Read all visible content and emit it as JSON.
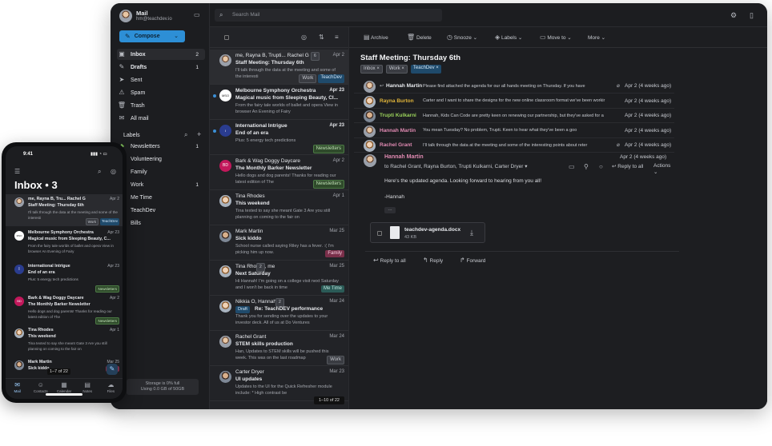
{
  "account": {
    "name": "Mail",
    "email": "hm@teachdev.io"
  },
  "search": {
    "placeholder": "Search Mail"
  },
  "compose": {
    "label": "Compose"
  },
  "folders": [
    {
      "label": "Inbox",
      "count": "2",
      "icon": "inbox-icon"
    },
    {
      "label": "Drafts",
      "count": "1",
      "icon": "drafts-icon"
    },
    {
      "label": "Sent",
      "count": "",
      "icon": "sent-icon"
    },
    {
      "label": "Spam",
      "count": "",
      "icon": "spam-icon"
    },
    {
      "label": "Trash",
      "count": "",
      "icon": "trash-icon"
    },
    {
      "label": "All mail",
      "count": "",
      "icon": "all-mail-icon"
    }
  ],
  "labels_heading": "Labels",
  "labels": [
    {
      "label": "Newsletters",
      "count": "1",
      "color": "#7fbf5a"
    },
    {
      "label": "Volunteering",
      "count": "",
      "color": "#e0a23a"
    },
    {
      "label": "Family",
      "count": "",
      "color": "#d9487a"
    },
    {
      "label": "Work",
      "count": "1",
      "color": "#9aa0aa"
    },
    {
      "label": "Me Time",
      "count": "",
      "color": "#3fb3a6"
    },
    {
      "label": "TeachDev",
      "count": "",
      "color": "#3b8fd6"
    },
    {
      "label": "Bills",
      "count": "",
      "color": "#e0a23a"
    }
  ],
  "storage": {
    "line1": "Storage is 0% full",
    "line2": "Using 0.0 GB of 50GB"
  },
  "toolbar": {
    "archive": "Archive",
    "delete": "Delete",
    "snooze": "Snooze",
    "labels": "Labels",
    "move_to": "Move to",
    "more": "More"
  },
  "messages": [
    {
      "from": "me, Rayna B, Trupti... Rachel G",
      "count": "6",
      "date": "Apr 2",
      "subject": "Staff Meeting: Thursday 6th",
      "preview": "I'll talk through the data at the meeting and some of the interesti",
      "tags": [
        "Work",
        "TeachDev"
      ]
    },
    {
      "from": "Melbourne Symphony Orchestra",
      "count": "",
      "date": "Apr 23",
      "subject": "Magical music from Sleeping Beauty, Cl...",
      "preview": "From the fairy tale worlds of ballet and opera View in browser An Evening of Fairy",
      "tags": []
    },
    {
      "from": "International Intrigue",
      "count": "",
      "date": "Apr 23",
      "subject": "End of an era",
      "preview": "Plus: 5 energy tech predictions",
      "tags": [
        "Newsletters"
      ]
    },
    {
      "from": "Bark & Wag Doggy Daycare",
      "count": "",
      "date": "Apr 2",
      "subject": "The Monthly Barker Newsletter",
      "preview": "Hello dogs and dog parents! Thanks for reading our latest edition of The",
      "tags": [
        "Newsletters"
      ]
    },
    {
      "from": "Tina Rhodes",
      "count": "",
      "date": "Apr 1",
      "subject": "This weekend",
      "preview": "Tina texted to say she meant Gate 3 Are you still planning on coming to the fair on",
      "tags": []
    },
    {
      "from": "Mark Martin",
      "count": "",
      "date": "Mar 25",
      "subject": "Sick kiddo",
      "preview": "School nurse called saying Riley has a fever. :( I'm picking him up now.",
      "tags": [
        "Family"
      ]
    },
    {
      "from": "Tina Rhodes, me",
      "count": "2",
      "date": "Mar 25",
      "subject": "Next Saturday",
      "preview": "Hi Hannah! I'm going on a college visit next Saturday and I won't be back in time",
      "tags": [
        "Me Time"
      ]
    },
    {
      "from": "Nikkia O, Hannah M",
      "count": "2",
      "date": "Mar 24",
      "subject": "Re: TeachDEV performance",
      "preview": "Thank you for sending over the updates to your investor deck. All of us at Do Ventures",
      "tags": [],
      "draft": "Draft"
    },
    {
      "from": "Rachel Grant",
      "count": "",
      "date": "Mar 24",
      "subject": "STEM skills production",
      "preview": "Han, Updates to STEM skills will be pushed this week. This was on the last roadmap",
      "tags": [
        "Work"
      ]
    },
    {
      "from": "Carter Dryer",
      "count": "",
      "date": "Mar 23",
      "subject": "UI updates",
      "preview": "Updates to the UI for the Quick Refresher module include: * High contrast be",
      "tags": []
    }
  ],
  "pagination": "1–10 of 22",
  "thread": {
    "title": "Staff Meeting: Thursday 6th",
    "tags": [
      "Inbox",
      "Work",
      "TeachDev"
    ],
    "items": [
      {
        "from": "Hannah Martin",
        "snippet": "Please find attached the agenda for our all hands meeting on Thursday. If you have",
        "date": "Apr 2 (4 weeks ago)",
        "color": "#e6e8ec"
      },
      {
        "from": "Rayna Burton",
        "snippet": "Carter and I want to share the designs for the new online classroom format we've been workir",
        "date": "Apr 2 (4 weeks ago)",
        "color": "#e0b43a"
      },
      {
        "from": "Trupti Kulkarni",
        "snippet": "Hannah, Kids Can Code are pretty keen on renewing our partnership, but they've asked for a",
        "date": "Apr 2 (4 weeks ago)",
        "color": "#9ad25a"
      },
      {
        "from": "Hannah Martin",
        "snippet": "You mean Tuesday? No problem, Trupti. Keen to hear what they've been a goo",
        "date": "Apr 2 (4 weeks ago)",
        "color": "#e08ab2"
      },
      {
        "from": "Rachel Grant",
        "snippet": "I'll talk through the data at the meeting and some of the interesting points about reter",
        "date": "Apr 2 (4 weeks ago)",
        "color": "#e08ab2"
      }
    ],
    "open": {
      "from": "Hannah Martin",
      "to": "to Rachel Grant, Rayna Burton, Trupti Kulkarni, Carter Dryer",
      "date": "Apr 2 (4 weeks ago)",
      "reply_all": "Reply to all",
      "actions": "Actions",
      "body1": "Here's the updated agenda. Looking forward to hearing from you all!",
      "body2": "-Hannah",
      "ellipsis": "···",
      "attachment": {
        "name": "teachdev-agenda.docx",
        "size": "43 KB"
      }
    },
    "buttons": {
      "reply_all": "Reply to all",
      "reply": "Reply",
      "forward": "Forward"
    }
  },
  "phone": {
    "time": "9:41",
    "title": "Inbox • 3",
    "messages": [
      {
        "from": "me, Rayna B, Tru... Rachel G",
        "count": "6",
        "date": "Apr 2",
        "subject": "Staff Meeting: Thursday 6th",
        "preview": "I'll talk through the data at the meeting and some of the interesti",
        "tags": [
          "Work",
          "TeachDev"
        ]
      },
      {
        "from": "Melbourne Symphony Orchestra",
        "date": "Apr 23",
        "subject": "Magical music from Sleeping Beauty, C...",
        "preview": "From the fairy tale worlds of ballet and opera View in browser An Evening of Fairy"
      },
      {
        "from": "International Intrigue",
        "date": "Apr 23",
        "subject": "End of an era",
        "preview": "Plus: 5 energy tech predictions",
        "tags": [
          "Newsletters"
        ]
      },
      {
        "from": "Bark & Wag Doggy Daycare",
        "date": "Apr 2",
        "subject": "The Monthly Barker Newsletter",
        "preview": "Hello dogs and dog parents! Thanks for reading our latest edition of The",
        "tags": [
          "Newsletters"
        ]
      },
      {
        "from": "Tina Rhodes",
        "date": "Apr 1",
        "subject": "This weekend",
        "preview": "Tina texted to say she meant Gate 3 Are you still planning on coming to the fair on"
      },
      {
        "from": "Mark Martin",
        "date": "Mar 25",
        "subject": "Sick kiddo",
        "preview": "School nurse",
        "tags": [
          "Family"
        ]
      }
    ],
    "pagination": "1–7 of 22",
    "tabs": [
      "Mail",
      "Contacts",
      "Calendar",
      "Notes",
      "Files"
    ]
  }
}
